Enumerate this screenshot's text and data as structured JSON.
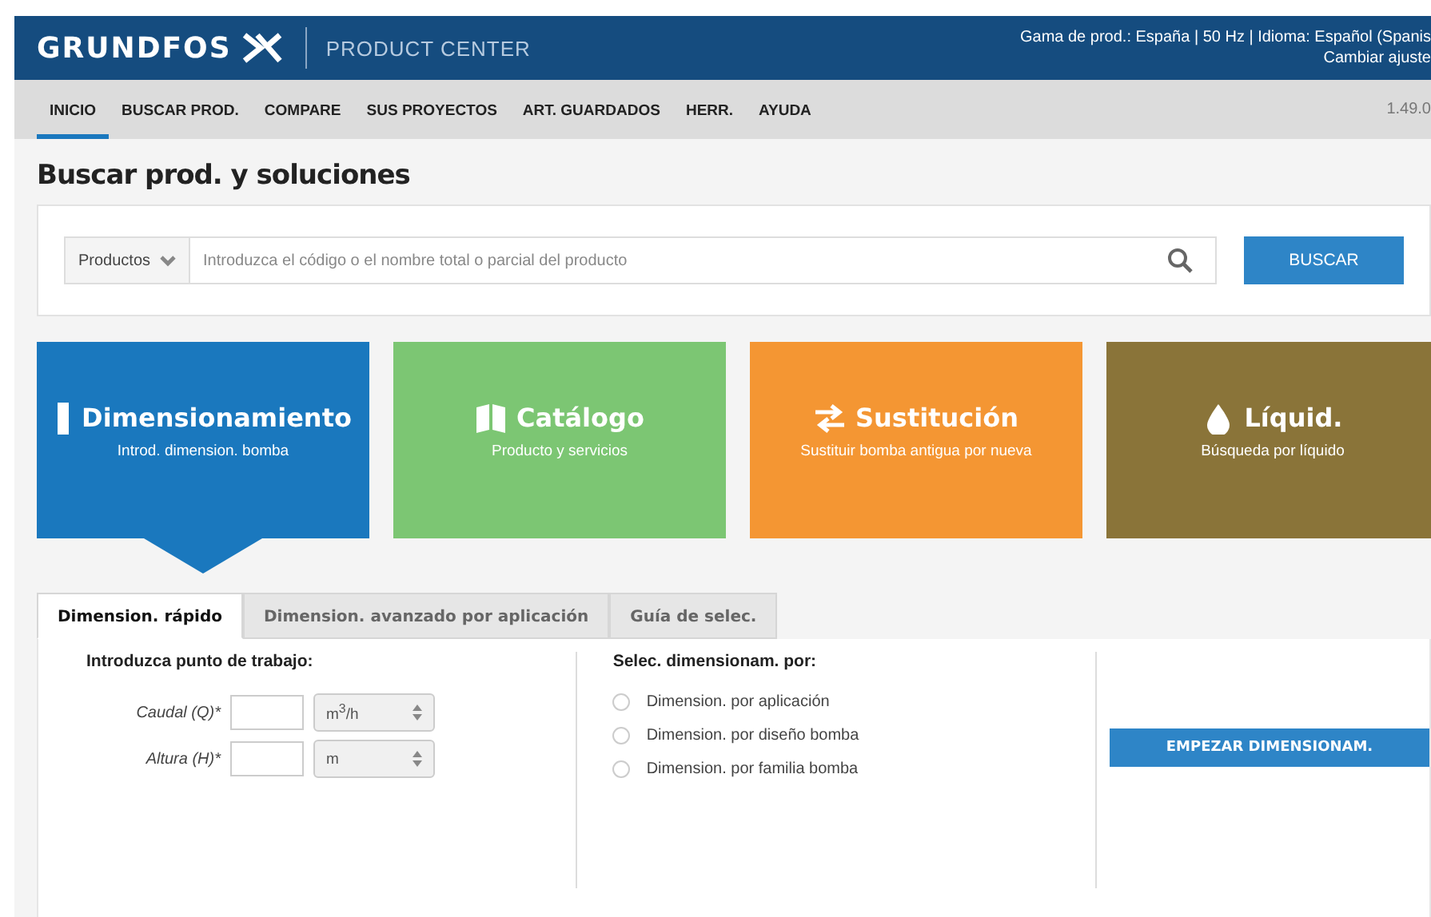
{
  "header": {
    "brand": "GRUNDFOS",
    "product": "PRODUCT CENTER",
    "settings": "Gama de prod.: España | 50 Hz | Idioma: Español (Spanis",
    "change_settings": "Cambiar ajuste"
  },
  "nav": {
    "items": [
      {
        "label": "INICIO",
        "selected": true
      },
      {
        "label": "BUSCAR PROD.",
        "selected": false
      },
      {
        "label": "COMPARE",
        "selected": false
      },
      {
        "label": "SUS PROYECTOS",
        "selected": false
      },
      {
        "label": "ART. GUARDADOS",
        "selected": false
      },
      {
        "label": "HERR.",
        "selected": false
      },
      {
        "label": "AYUDA",
        "selected": false
      }
    ],
    "version": "1.49.0"
  },
  "page_title": "Buscar prod. y soluciones",
  "search": {
    "category": "Productos",
    "placeholder": "Introduzca el código o el nombre total o parcial del producto",
    "button": "BUSCAR"
  },
  "tiles": [
    {
      "kind": "ruler",
      "title": "Dimensionamiento",
      "subtitle": "Introd. dimension. bomba",
      "color": "#1a78be",
      "selected": true
    },
    {
      "kind": "book",
      "title": "Catálogo",
      "subtitle": "Producto y servicios",
      "color": "#7cc673",
      "selected": false
    },
    {
      "kind": "swap",
      "title": "Sustitución",
      "subtitle": "Sustituir bomba antigua por nueva",
      "color": "#f49633",
      "selected": false
    },
    {
      "kind": "drop",
      "title": "Líquid.",
      "subtitle": "Búsqueda por líquido",
      "color": "#8a7439",
      "selected": false
    }
  ],
  "tabs": [
    {
      "label": "Dimension. rápido",
      "selected": true
    },
    {
      "label": "Dimension. avanzado por aplicación",
      "selected": false
    },
    {
      "label": "Guía de selec.",
      "selected": false
    }
  ],
  "work_point": {
    "heading": "Introduzca punto de trabajo:",
    "fields": [
      {
        "label": "Caudal (Q)*",
        "unit": "m$^{3}$/h"
      },
      {
        "label": "Altura (H)*",
        "unit": "m"
      }
    ]
  },
  "sizing_by": {
    "heading": "Selec. dimensionam. por:",
    "options": [
      {
        "label": "Dimension. por aplicación",
        "selected": false
      },
      {
        "label": "Dimension. por diseño bomba",
        "selected": false
      },
      {
        "label": "Dimension. por familia bomba",
        "selected": false
      }
    ]
  },
  "start_button": "EMPEZAR DIMENSIONAM."
}
